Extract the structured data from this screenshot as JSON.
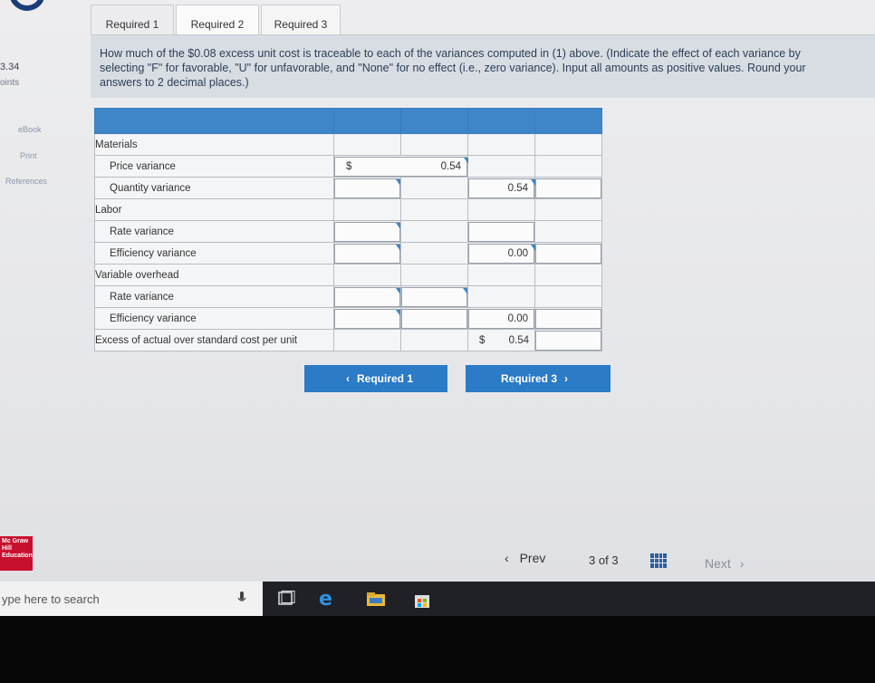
{
  "sidebar": {
    "score": "3.34",
    "score_label": "oints",
    "links": [
      "eBook",
      "Print",
      "References"
    ],
    "publisher_logo": "Mc Graw Hill Education"
  },
  "tabs": [
    {
      "label": "Required 1"
    },
    {
      "label": "Required 2",
      "active": true
    },
    {
      "label": "Required 3"
    }
  ],
  "question": "How much of the $0.08 excess unit cost is traceable to each of the variances computed in (1) above. (Indicate the effect of each variance by selecting \"F\" for favorable, \"U\" for unfavorable, and \"None\" for no effect (i.e., zero variance). Input all amounts as positive values. Round your answers to 2 decimal places.)",
  "table": {
    "rows": [
      {
        "label": "Materials",
        "indent": false
      },
      {
        "label": "Price variance",
        "indent": true,
        "value_dollar": "$",
        "value": "0.54"
      },
      {
        "label": "Quantity variance",
        "indent": true,
        "amount": "0.54"
      },
      {
        "label": "Labor",
        "indent": false
      },
      {
        "label": "Rate variance",
        "indent": true
      },
      {
        "label": "Efficiency variance",
        "indent": true,
        "amount": "0.00"
      },
      {
        "label": "Variable overhead",
        "indent": false
      },
      {
        "label": "Rate variance",
        "indent": true
      },
      {
        "label": "Efficiency variance",
        "indent": true,
        "amount": "0.00"
      },
      {
        "label": "Excess of actual over standard cost per unit",
        "indent": false,
        "total_dollar": "$",
        "amount": "0.54"
      }
    ]
  },
  "buttons": {
    "prev": "Required 1",
    "next": "Required 3"
  },
  "footer": {
    "prev": "Prev",
    "page": "3",
    "of": "of",
    "total": "3",
    "next": "Next"
  },
  "taskbar": {
    "search_placeholder": "ype here to search"
  },
  "colors": {
    "accent": "#2b7bc7",
    "header_blue": "#3f86c9",
    "brand_red": "#c8102e"
  }
}
